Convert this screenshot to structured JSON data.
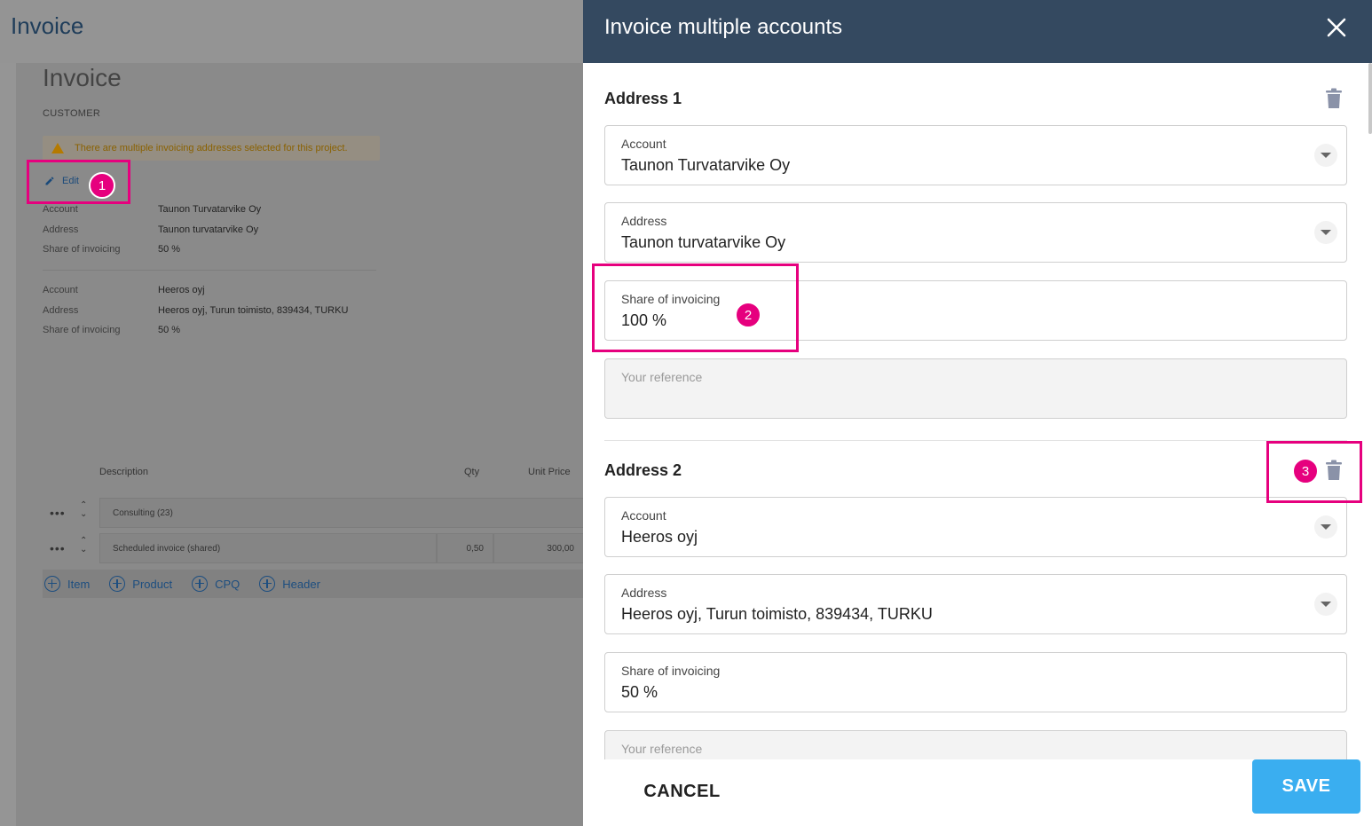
{
  "app": {
    "title": "Invoice"
  },
  "page": {
    "heading": "Invoice",
    "customer_label": "CUSTOMER",
    "warning": "There are multiple invoicing addresses selected for this project.",
    "edit_label": "Edit",
    "accounts": [
      {
        "account_label": "Account",
        "account": "Taunon Turvatarvike Oy",
        "address_label": "Address",
        "address": "Taunon turvatarvike Oy",
        "share_label": "Share of invoicing",
        "share": "50 %"
      },
      {
        "account_label": "Account",
        "account": "Heeros oyj",
        "address_label": "Address",
        "address": "Heeros oyj, Turun toimisto, 839434, TURKU",
        "share_label": "Share of invoicing",
        "share": "50 %"
      }
    ],
    "table": {
      "headers": {
        "description": "Description",
        "qty": "Qty",
        "unit_price": "Unit Price"
      },
      "rows": [
        {
          "description": "Consulting (23)",
          "qty": "",
          "unit_price": ""
        },
        {
          "description": "Scheduled invoice (shared)",
          "qty": "0,50",
          "unit_price": "300,00"
        }
      ],
      "add_buttons": [
        "Item",
        "Product",
        "CPQ",
        "Header"
      ]
    }
  },
  "panel": {
    "title": "Invoice multiple accounts",
    "addresses": [
      {
        "title": "Address 1",
        "account_label": "Account",
        "account": "Taunon Turvatarvike Oy",
        "address_label": "Address",
        "address": "Taunon turvatarvike Oy",
        "share_label": "Share of invoicing",
        "share": "100 %",
        "reference_placeholder": "Your reference"
      },
      {
        "title": "Address 2",
        "account_label": "Account",
        "account": "Heeros oyj",
        "address_label": "Address",
        "address": "Heeros oyj, Turun toimisto, 839434, TURKU",
        "share_label": "Share of invoicing",
        "share": "50 %",
        "reference_placeholder": "Your reference"
      }
    ],
    "cancel_label": "CANCEL",
    "save_label": "SAVE"
  },
  "callouts": [
    "1",
    "2",
    "3"
  ],
  "colors": {
    "header_bg": "#344960",
    "save_button": "#3aaef0",
    "callout": "#e6007e"
  },
  "icons": [
    "warning-icon",
    "pencil-icon",
    "plus-circle-icon",
    "close-icon",
    "trash-icon",
    "chevron-down-icon",
    "more-dots-icon",
    "reorder-icon"
  ]
}
